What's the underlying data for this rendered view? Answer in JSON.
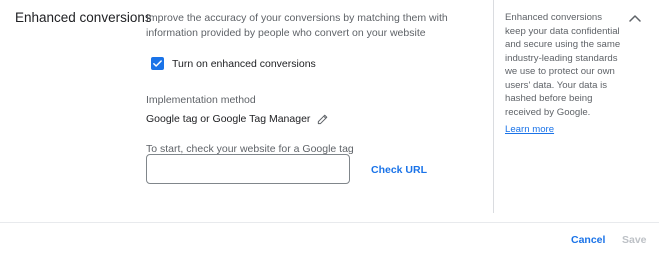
{
  "section": {
    "title": "Enhanced conversions",
    "description": "Improve the accuracy of your conversions by matching them with information provided by people who convert on your website"
  },
  "checkbox": {
    "label": "Turn on enhanced conversions",
    "checked": true,
    "check_icon": "check-icon"
  },
  "implementation": {
    "label": "Implementation method",
    "value": "Google tag or Google Tag Manager",
    "edit_icon": "pencil-icon"
  },
  "url_check": {
    "hint": "To start, check your website for a Google tag",
    "input_value": "",
    "button_label": "Check URL"
  },
  "help": {
    "text": "Enhanced conversions keep your data confidential and secure using the same industry-leading standards we use to protect our own users' data. Your data is hashed before being received by Google.",
    "link_label": "Learn more"
  },
  "collapse_icon": "chevron-up-icon",
  "footer": {
    "cancel_label": "Cancel",
    "save_label": "Save"
  },
  "colors": {
    "accent": "#1a73e8",
    "disabled": "#bdc1c6",
    "divider": "#dadce0"
  }
}
